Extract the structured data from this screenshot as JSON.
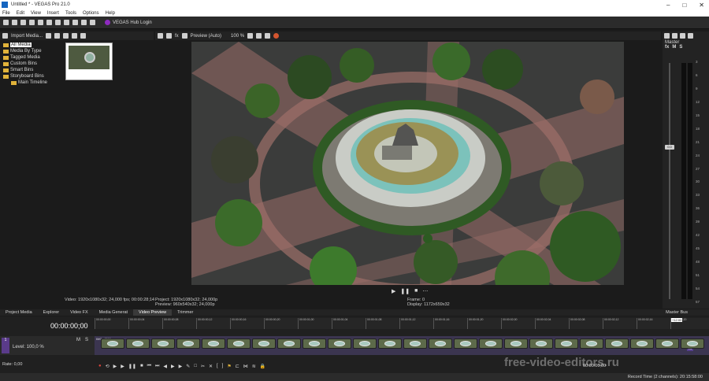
{
  "titlebar": {
    "title": "Untitled * - VEGAS Pro 21.0"
  },
  "menu": [
    "File",
    "Edit",
    "View",
    "Insert",
    "Tools",
    "Options",
    "Help"
  ],
  "toolbar": {
    "hub_label": "VEGAS Hub Login"
  },
  "project_media": {
    "import_label": "Import Media...",
    "tree": [
      "All Media",
      "Media By Type",
      "Tagged Media",
      "Custom Bins",
      "Smart Bins",
      "Storyboard Bins",
      "Main Timeline"
    ],
    "info": "Video: 1920x1080x32; 24,000 fps; 00:00:28;14"
  },
  "preview": {
    "mode": "Preview (Auto)",
    "zoom": "100 %",
    "project": "Project:  1920x1080x32; 24,000p",
    "preview_line": "Preview:  960x540x32; 24,000p",
    "frame": "Frame:    0",
    "display": "Display:  1172x659x32"
  },
  "master": {
    "title": "Master",
    "bus_label": "Master Bus",
    "fx": "fx",
    "m": "M",
    "s": "S",
    "scale": [
      "3",
      "6",
      "9",
      "12",
      "15",
      "18",
      "21",
      "24",
      "27",
      "30",
      "33",
      "36",
      "39",
      "42",
      "45",
      "48",
      "51",
      "54",
      "57"
    ],
    "level": "-Inf.",
    "meter_db": "0.0"
  },
  "tabs": [
    "Project Media",
    "Explorer",
    "Video FX",
    "Media Generat",
    "Video Preview",
    "Trimmer"
  ],
  "active_tab": "Video Preview",
  "timeline": {
    "timecode": "00:00:00;00",
    "level": "Level: 100,0 %",
    "rate": "Rate: 0,00",
    "track_num": "1",
    "clip_label": "IMG_4500",
    "m": "M",
    "s": "S",
    "ruler": [
      "00:00:00;00",
      "00:00:00;04",
      "00:00:00;08",
      "00:00:00;12",
      "00:00:00;16",
      "00:00:00;20",
      "00:00:01;00",
      "00:00:01;04",
      "00:00:01;08",
      "00:00:01;12",
      "00:00:01;16",
      "00:00:01;20",
      "00:00:02;00",
      "00:00:02;04",
      "00:00:02;08",
      "00:00:02;12",
      "00:00:02;16",
      "00:00:02;20"
    ],
    "ruler_end": "+12:00",
    "transport_time": "00:00:00;00",
    "fx": "fx"
  },
  "statusbar": {
    "record_time": "Record Time (2 channels): 20:15:58:00"
  },
  "watermark": "free-video-editors.ru"
}
